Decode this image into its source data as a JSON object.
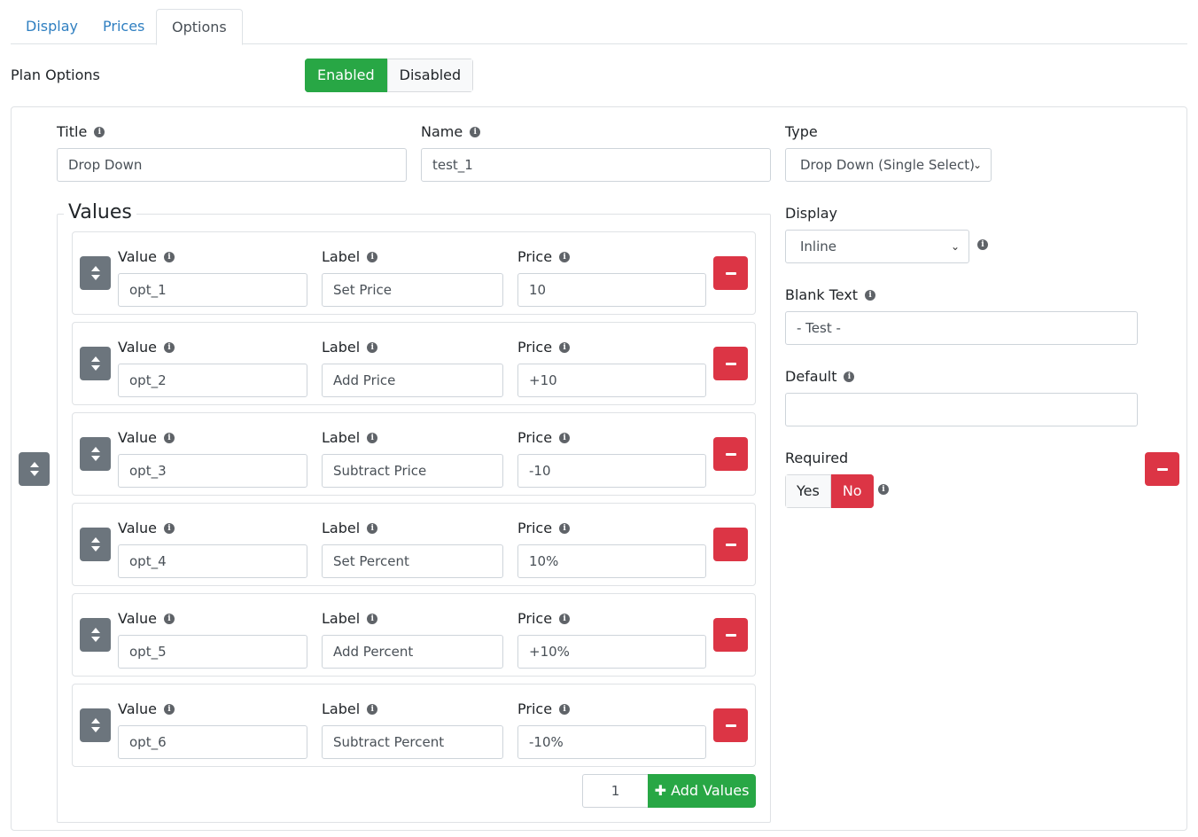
{
  "tabs": [
    {
      "label": "Display",
      "active": false
    },
    {
      "label": "Prices",
      "active": false
    },
    {
      "label": "Options",
      "active": true
    }
  ],
  "plan_options": {
    "label": "Plan Options",
    "enabled_label": "Enabled",
    "disabled_label": "Disabled",
    "selected": "Enabled"
  },
  "option": {
    "title_label": "Title",
    "title_value": "Drop Down",
    "name_label": "Name",
    "name_value": "test_1",
    "type_label": "Type",
    "type_value": "Drop Down (Single Select)",
    "display_label": "Display",
    "display_value": "Inline",
    "blank_text_label": "Blank Text",
    "blank_text_value": "- Test -",
    "default_label": "Default",
    "default_value": "",
    "required_label": "Required",
    "required_yes": "Yes",
    "required_no": "No",
    "required_selected": "No"
  },
  "values_section": {
    "legend": "Values",
    "value_label": "Value",
    "label_label": "Label",
    "price_label": "Price",
    "rows": [
      {
        "value": "opt_1",
        "label": "Set Price",
        "price": "10"
      },
      {
        "value": "opt_2",
        "label": "Add Price",
        "price": "+10"
      },
      {
        "value": "opt_3",
        "label": "Subtract Price",
        "price": "-10"
      },
      {
        "value": "opt_4",
        "label": "Set Percent",
        "price": "10%"
      },
      {
        "value": "opt_5",
        "label": "Add Percent",
        "price": "+10%"
      },
      {
        "value": "opt_6",
        "label": "Subtract Percent",
        "price": "-10%"
      }
    ],
    "add_quantity": "1",
    "add_button_label": "Add Values"
  },
  "colors": {
    "success": "#28a745",
    "danger": "#dc3545",
    "secondary": "#6c757d",
    "link": "#2f7fc1"
  }
}
